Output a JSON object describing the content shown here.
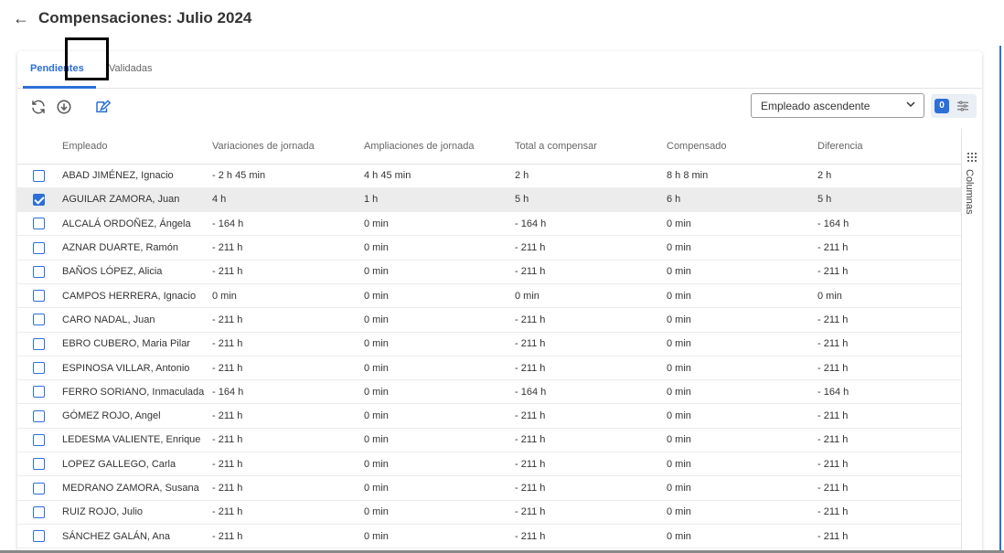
{
  "header": {
    "back_icon": "arrow-left-icon",
    "title": "Compensaciones: Julio 2024"
  },
  "tabs": [
    {
      "label": "Pendientes",
      "active": true
    },
    {
      "label": "Validadas",
      "active": false
    }
  ],
  "toolbar": {
    "icons": [
      "refresh-icon",
      "download-icon",
      "edit-document-icon"
    ],
    "sort_value": "Empleado ascendente",
    "filter_count": "0"
  },
  "side_panel": {
    "label": "Columnas"
  },
  "table": {
    "columns": [
      "Empleado",
      "Variaciones de jornada",
      "Ampliaciones de jornada",
      "Total a compensar",
      "Compensado",
      "Diferencia"
    ],
    "rows": [
      {
        "checked": false,
        "cells": [
          "ABAD JIMÉNEZ, Ignacio",
          "- 2 h 45 min",
          "4 h 45 min",
          "2 h",
          "8 h 8 min",
          "2 h"
        ]
      },
      {
        "checked": true,
        "cells": [
          "AGUILAR ZAMORA, Juan",
          "4 h",
          "1 h",
          "5 h",
          "6 h",
          "5 h"
        ]
      },
      {
        "checked": false,
        "cells": [
          "ALCALÁ ORDOÑEZ, Ángela",
          "- 164 h",
          "0 min",
          "- 164 h",
          "0 min",
          "- 164 h"
        ]
      },
      {
        "checked": false,
        "cells": [
          "AZNAR DUARTE, Ramón",
          "- 211 h",
          "0 min",
          "- 211 h",
          "0 min",
          "- 211 h"
        ]
      },
      {
        "checked": false,
        "cells": [
          "BAÑOS LÓPEZ, Alicia",
          "- 211 h",
          "0 min",
          "- 211 h",
          "0 min",
          "- 211 h"
        ]
      },
      {
        "checked": false,
        "cells": [
          "CAMPOS HERRERA, Ignacio",
          "0 min",
          "0 min",
          "0 min",
          "0 min",
          "0 min"
        ]
      },
      {
        "checked": false,
        "cells": [
          "CARO NADAL, Juan",
          "- 211 h",
          "0 min",
          "- 211 h",
          "0 min",
          "- 211 h"
        ]
      },
      {
        "checked": false,
        "cells": [
          "EBRO CUBERO, Maria Pilar",
          "- 211 h",
          "0 min",
          "- 211 h",
          "0 min",
          "- 211 h"
        ]
      },
      {
        "checked": false,
        "cells": [
          "ESPINOSA VILLAR, Antonio",
          "- 211 h",
          "0 min",
          "- 211 h",
          "0 min",
          "- 211 h"
        ]
      },
      {
        "checked": false,
        "cells": [
          "FERRO SORIANO, Inmaculada",
          "- 164 h",
          "0 min",
          "- 164 h",
          "0 min",
          "- 164 h"
        ]
      },
      {
        "checked": false,
        "cells": [
          "GÓMEZ ROJO, Angel",
          "- 211 h",
          "0 min",
          "- 211 h",
          "0 min",
          "- 211 h"
        ]
      },
      {
        "checked": false,
        "cells": [
          "LEDESMA VALIENTE, Enrique",
          "- 211 h",
          "0 min",
          "- 211 h",
          "0 min",
          "- 211 h"
        ]
      },
      {
        "checked": false,
        "cells": [
          "LOPEZ GALLEGO, Carla",
          "- 211 h",
          "0 min",
          "- 211 h",
          "0 min",
          "- 211 h"
        ]
      },
      {
        "checked": false,
        "cells": [
          "MEDRANO ZAMORA, Susana",
          "- 211 h",
          "0 min",
          "- 211 h",
          "0 min",
          "- 211 h"
        ]
      },
      {
        "checked": false,
        "cells": [
          "RUIZ ROJO, Julio",
          "- 211 h",
          "0 min",
          "- 211 h",
          "0 min",
          "- 211 h"
        ]
      },
      {
        "checked": false,
        "cells": [
          "SÁNCHEZ GALÁN, Ana",
          "- 211 h",
          "0 min",
          "- 211 h",
          "0 min",
          "- 211 h"
        ]
      }
    ]
  },
  "colors": {
    "accent": "#2c6fd6",
    "selected_row": "#ececec"
  }
}
